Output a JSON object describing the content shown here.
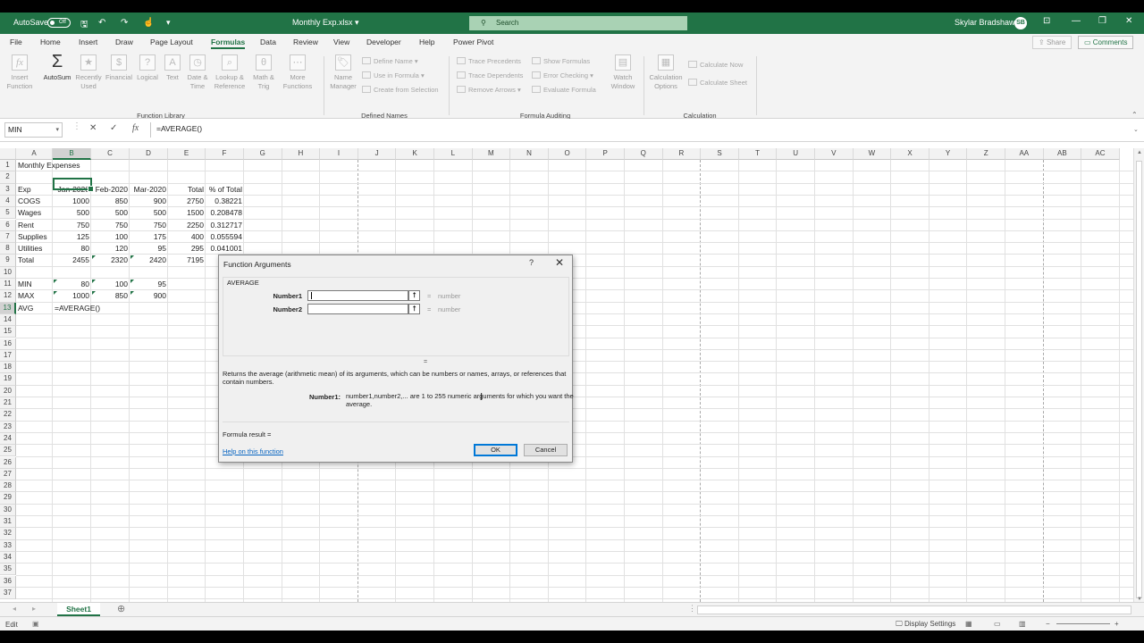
{
  "titlebar": {
    "autosave_label": "AutoSave",
    "autosave_state": "Off",
    "file_name": "Monthly Exp.xlsx",
    "search_placeholder": "Search",
    "user_name": "Skylar Bradshaw",
    "user_initials": "SB"
  },
  "menu": {
    "items": [
      "File",
      "Home",
      "Insert",
      "Draw",
      "Page Layout",
      "Formulas",
      "Data",
      "Review",
      "View",
      "Developer",
      "Help",
      "Power Pivot"
    ],
    "active": "Formulas",
    "share_label": "Share",
    "comments_label": "Comments"
  },
  "ribbon": {
    "insert_function": "Insert Function",
    "autosum": "AutoSum",
    "recently_used": "Recently Used",
    "financial": "Financial",
    "logical": "Logical",
    "text": "Text",
    "date_time": "Date & Time",
    "lookup_reference": "Lookup & Reference",
    "math_trig": "Math & Trig",
    "more_functions": "More Functions",
    "group_function_library": "Function Library",
    "name_manager": "Name Manager",
    "define_name": "Define Name",
    "use_in_formula": "Use in Formula",
    "create_from_selection": "Create from Selection",
    "group_defined_names": "Defined Names",
    "trace_precedents": "Trace Precedents",
    "trace_dependents": "Trace Dependents",
    "remove_arrows": "Remove Arrows",
    "show_formulas": "Show Formulas",
    "error_checking": "Error Checking",
    "evaluate_formula": "Evaluate Formula",
    "watch_window": "Watch Window",
    "group_formula_auditing": "Formula Auditing",
    "calculation_options": "Calculation Options",
    "calculate_now": "Calculate Now",
    "calculate_sheet": "Calculate Sheet",
    "group_calculation": "Calculation"
  },
  "formula_bar": {
    "name_box": "MIN",
    "formula": "=AVERAGE()"
  },
  "columns": [
    "A",
    "B",
    "C",
    "D",
    "E",
    "F",
    "G",
    "H",
    "I",
    "J",
    "K",
    "L",
    "M",
    "N",
    "O",
    "P",
    "Q",
    "R",
    "S",
    "T",
    "U",
    "V",
    "W",
    "X",
    "Y",
    "Z",
    "AA",
    "AB",
    "AC"
  ],
  "selected_column": "B",
  "selected_row": 13,
  "row_count": 37,
  "sheet": {
    "title": "Monthly Expenses",
    "header": [
      "Exp",
      "Jan-2020",
      "Feb-2020",
      "Mar-2020",
      "Total",
      "% of Total"
    ],
    "rows": [
      [
        "COGS",
        "1000",
        "850",
        "900",
        "2750",
        "0.38221"
      ],
      [
        "Wages",
        "500",
        "500",
        "500",
        "1500",
        "0.208478"
      ],
      [
        "Rent",
        "750",
        "750",
        "750",
        "2250",
        "0.312717"
      ],
      [
        "Supplies",
        "125",
        "100",
        "175",
        "400",
        "0.055594"
      ],
      [
        "Utilities",
        "80",
        "120",
        "95",
        "295",
        "0.041001"
      ],
      [
        "Total",
        "2455",
        "2320",
        "2420",
        "7195",
        ""
      ]
    ],
    "stats": [
      [
        "MIN",
        "80",
        "100",
        "95"
      ],
      [
        "MAX",
        "1000",
        "850",
        "900"
      ],
      [
        "AVG",
        "=AVERAGE()",
        "",
        ""
      ]
    ]
  },
  "dialog": {
    "title": "Function Arguments",
    "help_glyph": "?",
    "close_glyph": "✕",
    "function_name": "AVERAGE",
    "arg1_label": "Number1",
    "arg2_label": "Number2",
    "equals": "=",
    "arg1_result": "number",
    "arg2_result": "number",
    "description": "Returns the average (arithmetic mean) of its arguments, which can be numbers or names, arrays, or references that contain numbers.",
    "arg_desc_name": "Number1:",
    "arg_desc": "number1,number2,... are 1 to 255 numeric arguments for which you want the average.",
    "formula_result": "Formula result =",
    "help_link": "Help on this function",
    "ok": "OK",
    "cancel": "Cancel"
  },
  "tabs": {
    "sheet1": "Sheet1"
  },
  "status": {
    "mode": "Edit",
    "display_settings": "Display Settings"
  },
  "colors": {
    "excel_green": "#217346",
    "dialog_bg": "#f0f0f0",
    "link_blue": "#0563c1"
  }
}
